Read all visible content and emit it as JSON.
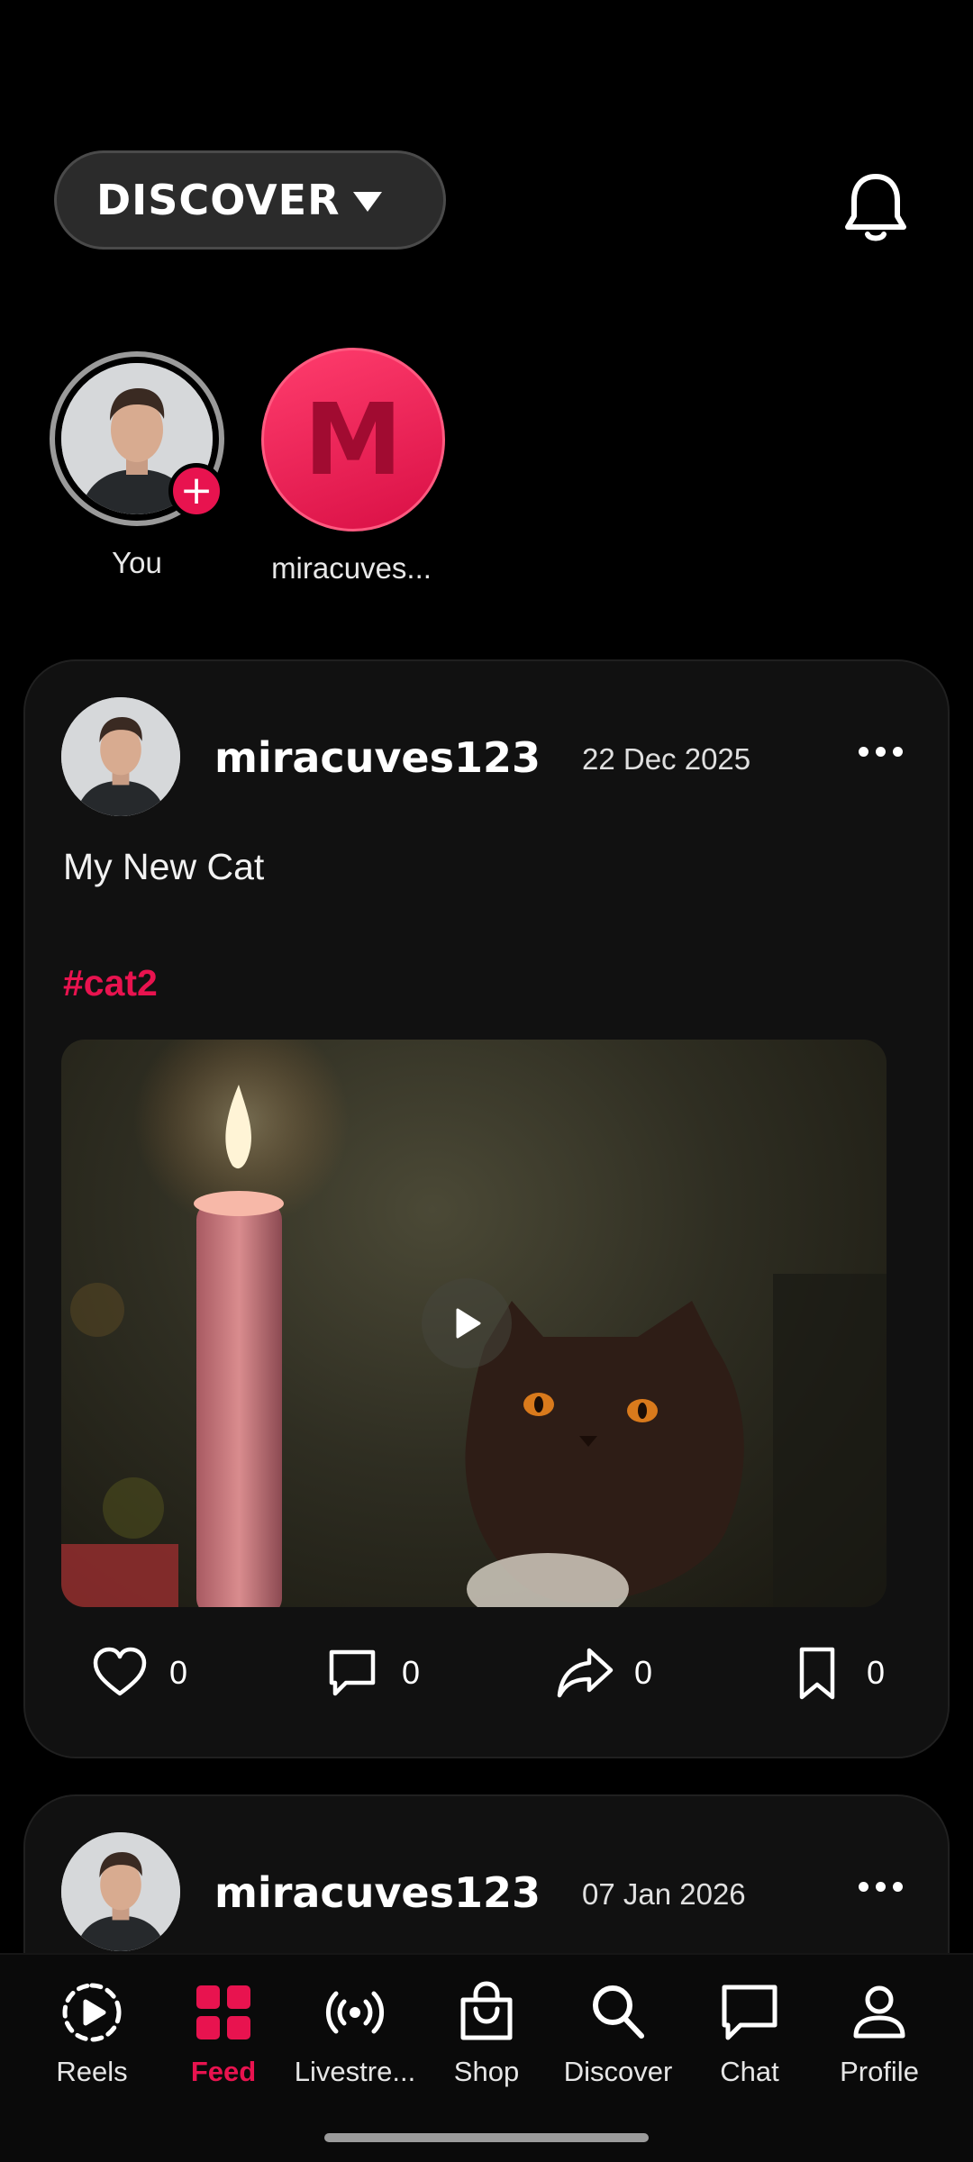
{
  "header": {
    "title": "DISCOVER"
  },
  "stories": [
    {
      "label": "You"
    },
    {
      "initial": "M",
      "label": "miracuves..."
    }
  ],
  "posts": [
    {
      "username": "miracuves123",
      "date": "22 Dec 2025",
      "caption": "My New Cat",
      "hashtag": "#cat2",
      "likes": "0",
      "comments": "0",
      "shares": "0",
      "saves": "0"
    },
    {
      "username": "miracuves123",
      "date": "07 Jan 2026"
    }
  ],
  "nav": [
    {
      "label": "Reels",
      "icon": "reels-icon"
    },
    {
      "label": "Feed",
      "icon": "feed-grid-icon",
      "active": true
    },
    {
      "label": "Livestre...",
      "icon": "livestream-icon"
    },
    {
      "label": "Shop",
      "icon": "shopping-bag-icon"
    },
    {
      "label": "Discover",
      "icon": "search-icon"
    },
    {
      "label": "Chat",
      "icon": "chat-icon"
    },
    {
      "label": "Profile",
      "icon": "profile-icon"
    }
  ],
  "colors": {
    "accent": "#e8134f",
    "background": "#000000",
    "card": "#111111"
  }
}
